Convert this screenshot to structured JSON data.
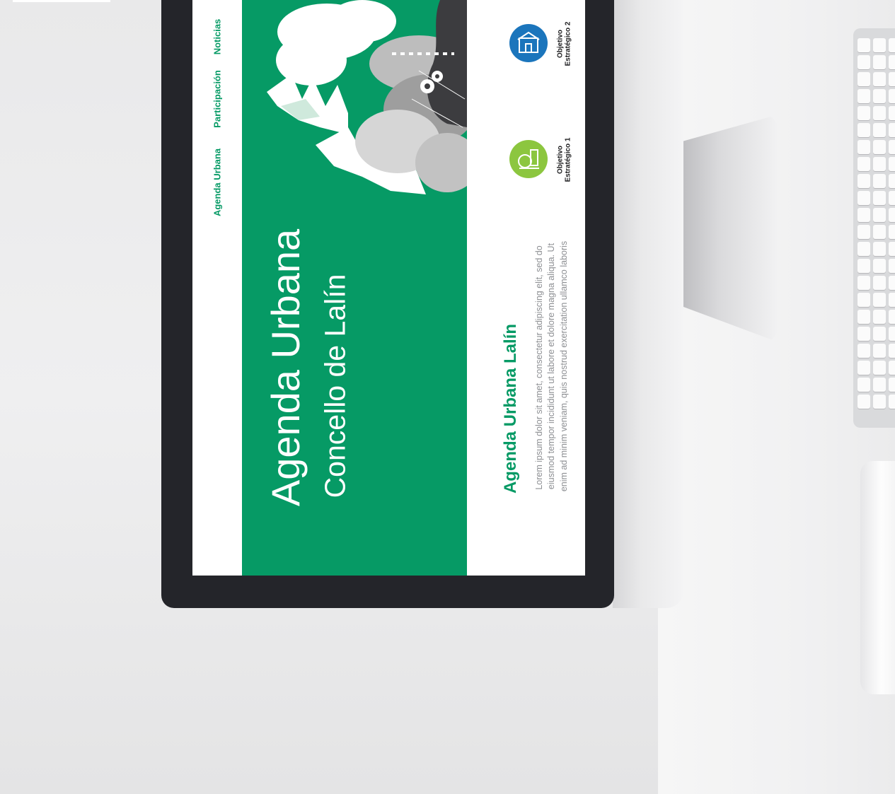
{
  "nav": {
    "items": [
      {
        "label": "Agenda Urbana"
      },
      {
        "label": "Participación"
      },
      {
        "label": "Noticias"
      }
    ]
  },
  "hero": {
    "title": "Agenda Urbana",
    "subtitle": "Concello de Lalín"
  },
  "section": {
    "title": "Agenda Urbana Lalín",
    "lines": [
      "Lorem ipsum dolor sit amet, consectetur adipiscing elit, sed do",
      "eiusmod tempor incididunt ut labore et dolore magna aliqua. Ut",
      "enim ad minim veniam, quis nostrud exercitation ullamco laboris"
    ]
  },
  "objectives": [
    {
      "line1": "Objetivo",
      "line2": "Estratégico 1",
      "icon": "park-icon",
      "color": "#8cc63f"
    },
    {
      "line1": "Objetivo",
      "line2": "Estratégico 2",
      "icon": "building-icon",
      "color": "#1b75bc"
    }
  ],
  "colors": {
    "brand_green": "#069a65",
    "bezel": "#24252a",
    "text_gray": "#8d8f93"
  }
}
